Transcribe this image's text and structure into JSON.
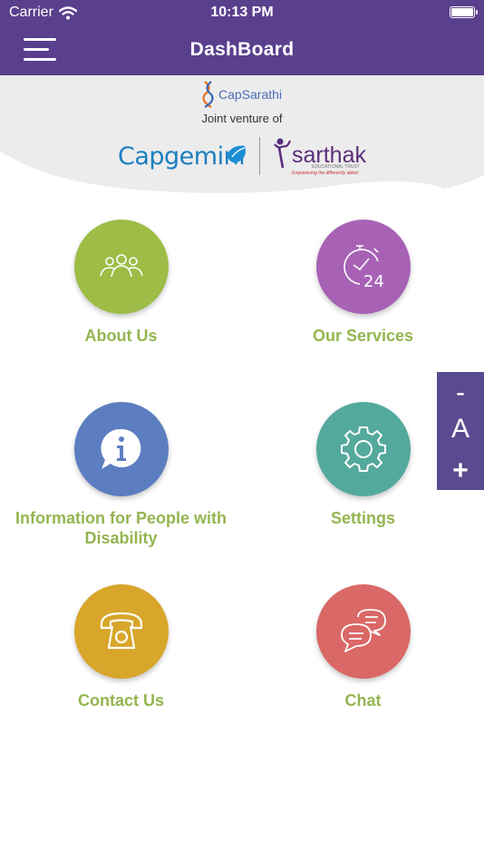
{
  "status_bar": {
    "carrier": "Carrier",
    "time": "10:13 PM"
  },
  "header": {
    "title": "DashBoard"
  },
  "banner": {
    "capsarathi": "CapSarathi",
    "joint_venture": "Joint venture of",
    "capgemini": "Capgemini",
    "sarthak": "sarthak",
    "sarthak_subtitle": "EDUCATIONAL TRUST",
    "sarthak_tagline": "Empowering the differently abled"
  },
  "tiles": [
    {
      "label": "About Us",
      "icon": "people-group-icon",
      "color": "#9dbd46"
    },
    {
      "label": "Our Services",
      "icon": "clock-24-icon",
      "color": "#a762b5"
    },
    {
      "label": "Information for People with Disability",
      "icon": "info-chat-icon",
      "color": "#5c7ec0"
    },
    {
      "label": "Settings",
      "icon": "gear-icon",
      "color": "#54a99d"
    },
    {
      "label": "Contact Us",
      "icon": "telephone-icon",
      "color": "#d7a62a"
    },
    {
      "label": "Chat",
      "icon": "chat-bubbles-icon",
      "color": "#d96866"
    }
  ],
  "font_controls": {
    "decrease": "-",
    "label": "A",
    "increase": "+"
  },
  "colors": {
    "header_bg": "#5a3f8c",
    "label_green": "#94b550",
    "font_panel": "#5a4a8f"
  }
}
